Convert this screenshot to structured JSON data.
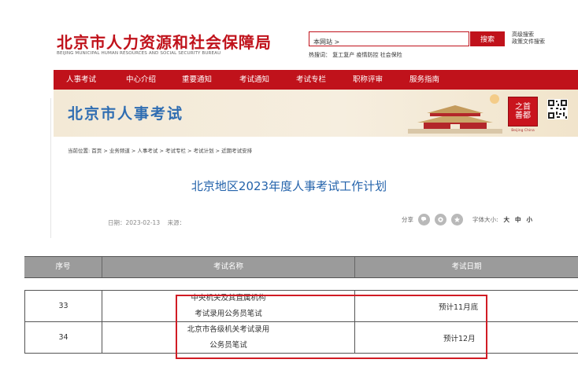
{
  "header": {
    "title": "北京市人力资源和社会保障局",
    "subtitle": "BEIJING MUNICIPAL HUMAN RESOURCES AND SOCIAL SECURITY BUREAU"
  },
  "search": {
    "value": "本网站 >",
    "button": "搜索",
    "hot_label": "热搜词：",
    "hot_terms": "复工复产 疫情防控 社会保险",
    "advanced": "高级搜索",
    "policy": "政策文件搜索"
  },
  "nav": {
    "items": [
      {
        "label": "人事考试"
      },
      {
        "label": "中心介绍"
      },
      {
        "label": "重要通知"
      },
      {
        "label": "考试通知"
      },
      {
        "label": "考试专栏"
      },
      {
        "label": "职称评审"
      },
      {
        "label": "服务指南"
      }
    ]
  },
  "banner": {
    "title": "北京市人事考试",
    "seal_line1": "之首",
    "seal_line2": "善都",
    "seal_sub": "Beijing China"
  },
  "breadcrumb": "当前位置: 首页 > 业务频道 > 人事考试 > 考试专栏 > 考试计划 > 近期考试安排",
  "article": {
    "title": "北京地区2023年度人事考试工作计划",
    "date_label": "日期：",
    "date": "2023-02-13",
    "source_label": "来源：",
    "share_label": "分享",
    "font_size_label": "字体大小:",
    "font_large": "大",
    "font_medium": "中",
    "font_small": "小"
  },
  "table": {
    "headers": [
      "序号",
      "考试名称",
      "考试日期"
    ],
    "rows": [
      {
        "num": "33",
        "name_line1": "中央机关及其直属机构",
        "name_line2": "考试录用公务员笔试",
        "date": "预计11月底"
      },
      {
        "num": "34",
        "name_line1": "北京市各级机关考试录用",
        "name_line2": "公务员笔试",
        "date": "预计12月"
      }
    ]
  },
  "colors": {
    "brand_red": "#c0121b",
    "title_blue": "#2463ab",
    "header_gray": "#9b9b9b",
    "highlight_red": "#d11c24"
  }
}
